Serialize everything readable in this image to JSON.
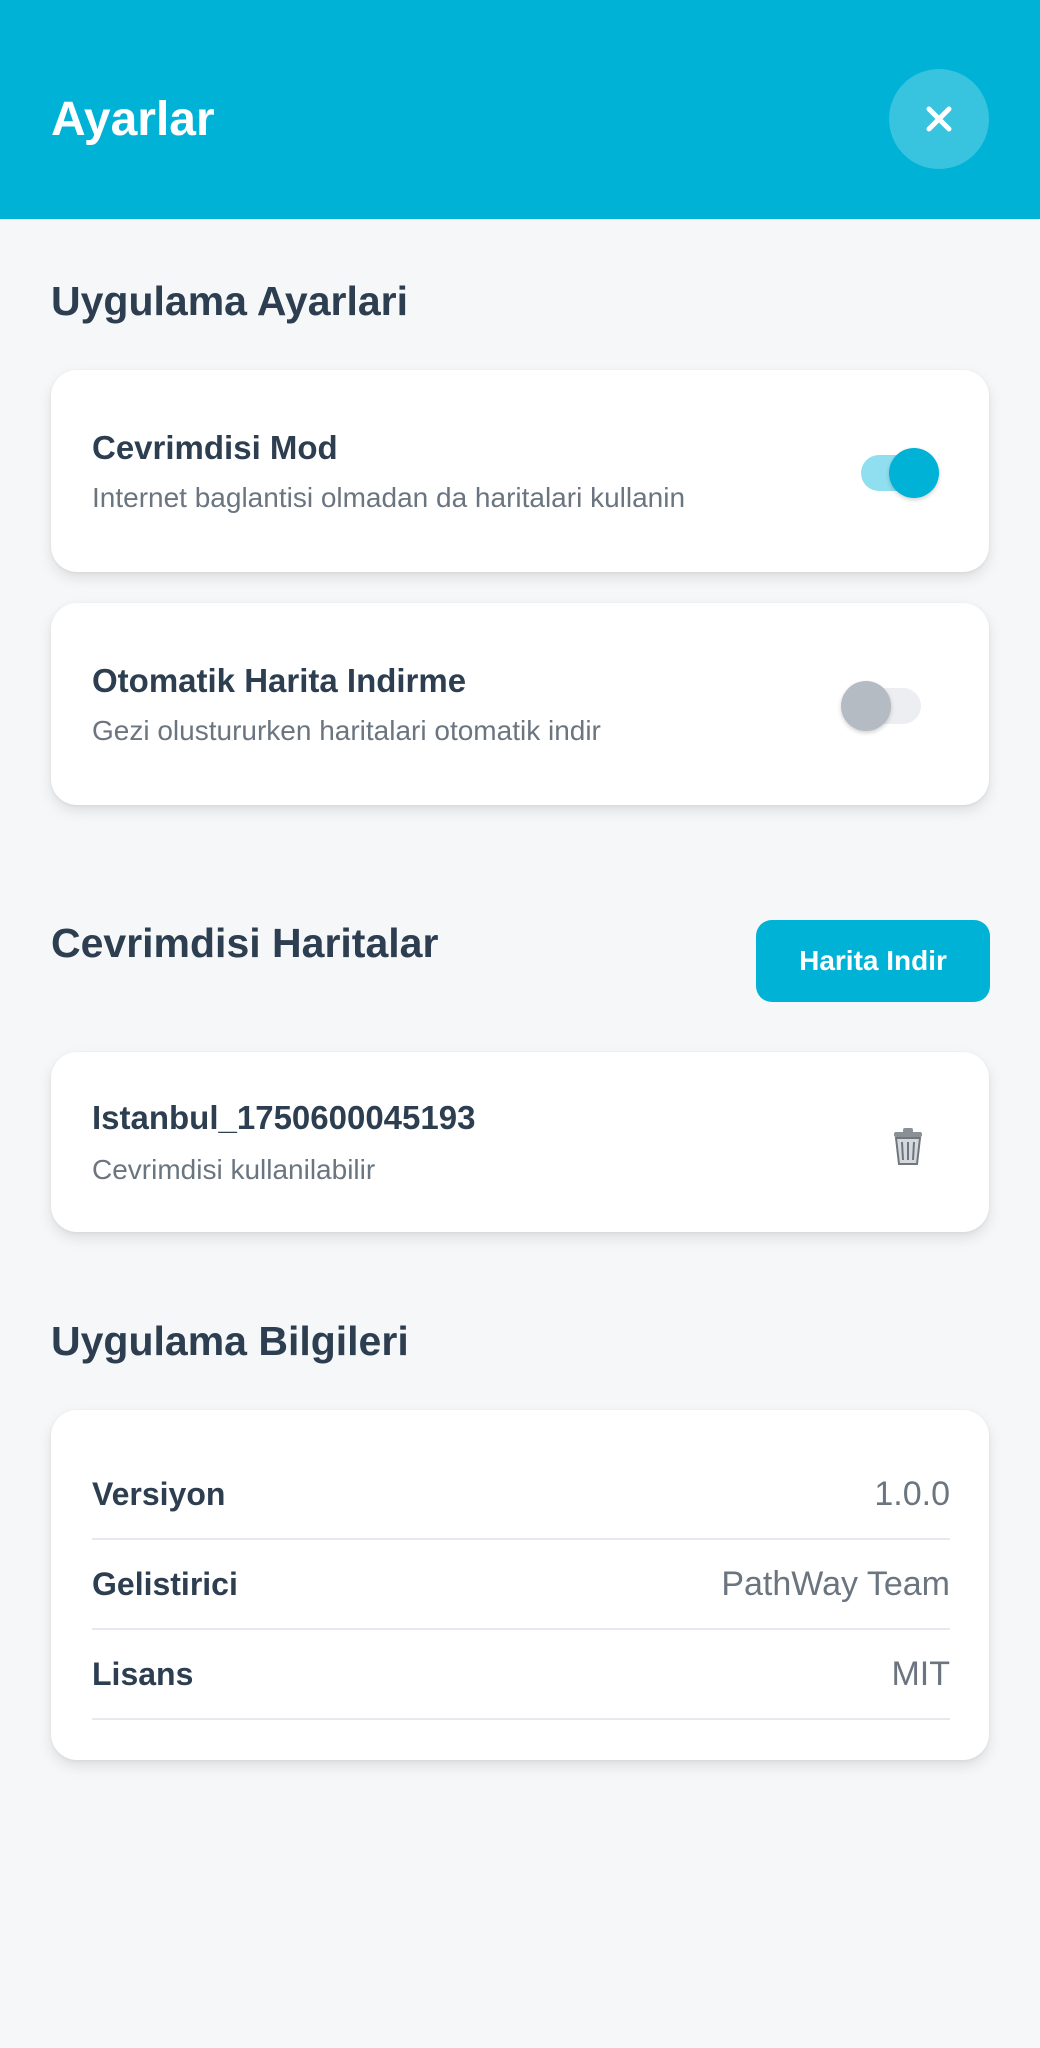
{
  "header": {
    "title": "Ayarlar",
    "close_icon": "close-icon"
  },
  "app_settings": {
    "section_title": "Uygulama Ayarlari",
    "offline_mode": {
      "title": "Cevrimdisi Mod",
      "subtitle": "Internet baglantisi olmadan da haritalari kullanin",
      "enabled": true
    },
    "auto_download": {
      "title": "Otomatik Harita Indirme",
      "subtitle": "Gezi olustururken haritalari otomatik indir",
      "enabled": false
    }
  },
  "offline_maps": {
    "section_title": "Cevrimdisi Haritalar",
    "download_button": "Harita Indir",
    "items": [
      {
        "name": "Istanbul_1750600045193",
        "status": "Cevrimdisi kullanilabilir",
        "delete_icon": "trash-icon"
      }
    ]
  },
  "app_info": {
    "section_title": "Uygulama Bilgileri",
    "rows": [
      {
        "label": "Versiyon",
        "value": "1.0.0"
      },
      {
        "label": "Gelistirici",
        "value": "PathWay Team"
      },
      {
        "label": "Lisans",
        "value": "MIT"
      }
    ]
  },
  "colors": {
    "accent": "#00b2d6",
    "toggle_on_track": "#8fdff0",
    "toggle_off_track": "#eceef1",
    "toggle_off_knob": "#b5bbc2",
    "text_primary": "#2c3e50",
    "text_secondary": "#6b7580"
  }
}
